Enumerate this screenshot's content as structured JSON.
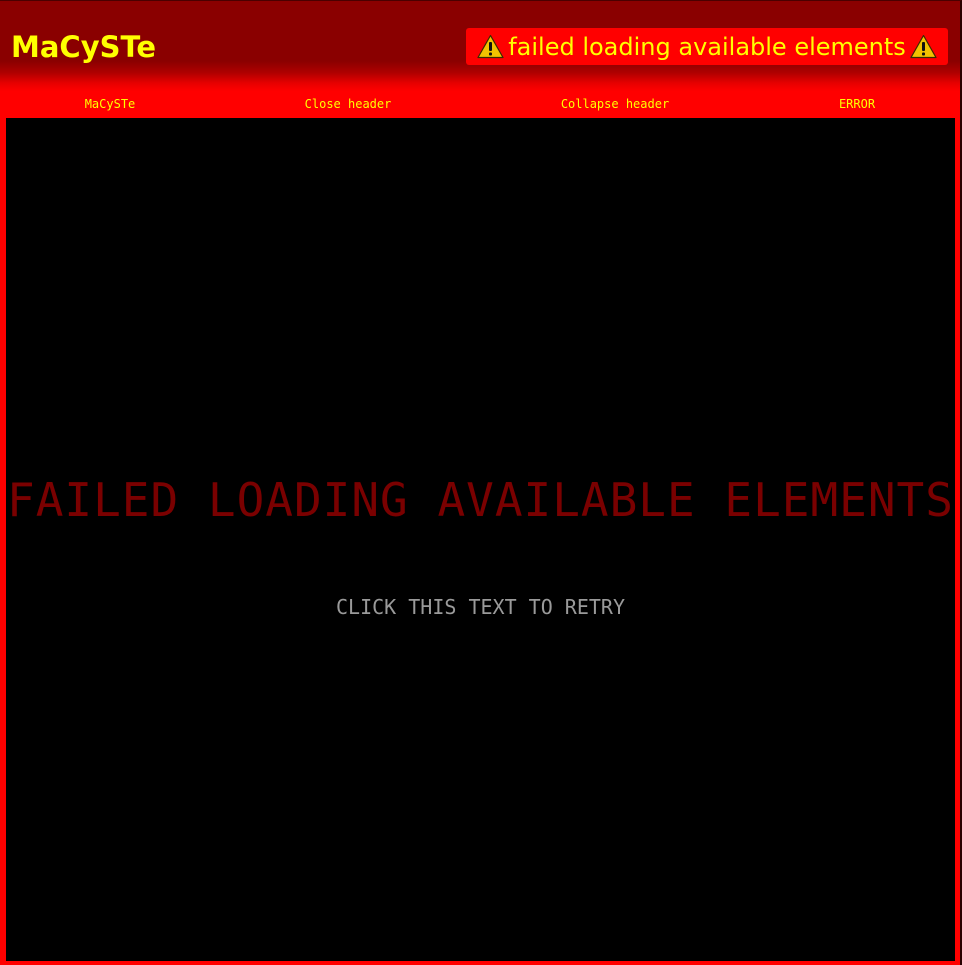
{
  "header": {
    "title": "MaCySTe",
    "error_banner": "failed loading available elements"
  },
  "nav": {
    "items": [
      {
        "label": "MaCySTe"
      },
      {
        "label": "Close header"
      },
      {
        "label": "Collapse header"
      },
      {
        "label": "ERROR"
      }
    ]
  },
  "main": {
    "error_heading": "FAILED LOADING AVAILABLE ELEMENTS",
    "retry_text": "CLICK THIS TEXT TO RETRY"
  },
  "icons": {
    "banner_left": "warning-icon",
    "banner_right": "warning-icon"
  },
  "colors": {
    "header_dark_red": "#8a0000",
    "accent_red": "#ff0000",
    "text_yellow": "#ffff00",
    "error_heading": "#7a0000",
    "retry_text": "#9a9a9a"
  }
}
